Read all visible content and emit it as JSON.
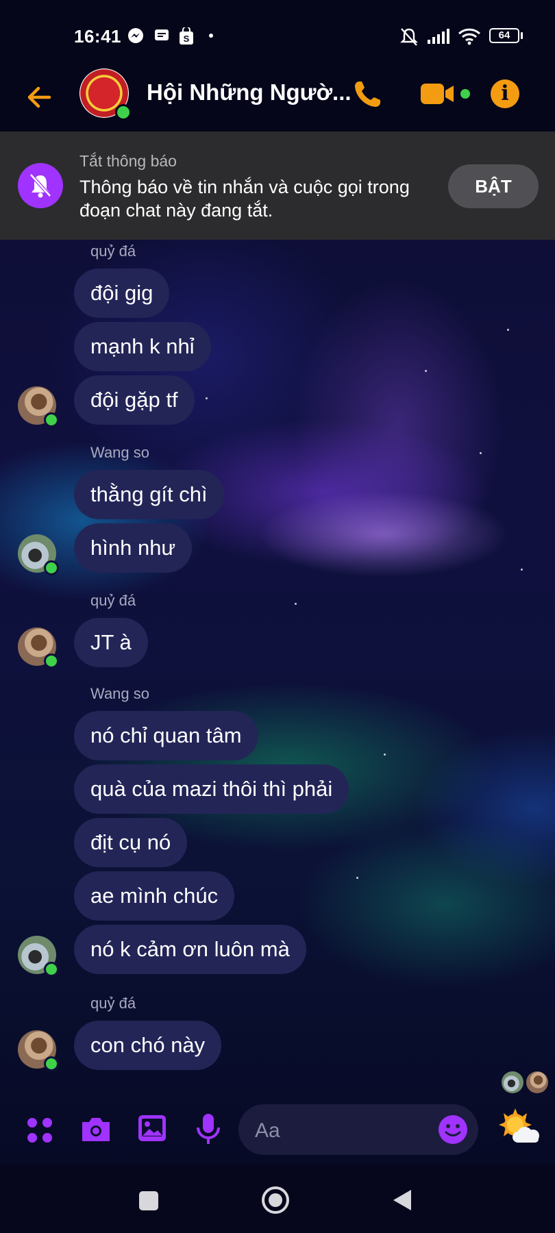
{
  "status_bar": {
    "time": "16:41",
    "battery": "64"
  },
  "header": {
    "title": "Hội Những Ngườ...",
    "back_icon": "arrow-left-icon",
    "call_icon": "phone-icon",
    "video_icon": "video-icon",
    "info_icon": "info-icon",
    "accent_color": "#f39c12"
  },
  "banner": {
    "title": "Tắt thông báo",
    "text": "Thông báo về tin nhắn và cuộc gọi trong đoạn chat này đang tắt.",
    "button": "BẬT"
  },
  "messages": {
    "sender_1": "quỷ đá",
    "m1": "đội gig",
    "m2": "mạnh k nhỉ",
    "m3": "đội gặp tf",
    "sender_2": "Wang so",
    "m4": "thằng gít chì",
    "m5": "hình như",
    "sender_3": "quỷ đá",
    "m6": "JT à",
    "sender_4": "Wang so",
    "m7": "nó chỉ quan tâm",
    "m8": "quà của mazi thôi thì phải",
    "m9": "địt cụ nó",
    "m10": "ae mình chúc",
    "m11": "nó k cảm ơn luôn mà",
    "sender_5": "quỷ đá",
    "m12": "con chó này"
  },
  "composer": {
    "placeholder": "Aa"
  },
  "colors": {
    "bubble": "#232557",
    "purple": "#a033ff",
    "online": "#3fd14a"
  }
}
